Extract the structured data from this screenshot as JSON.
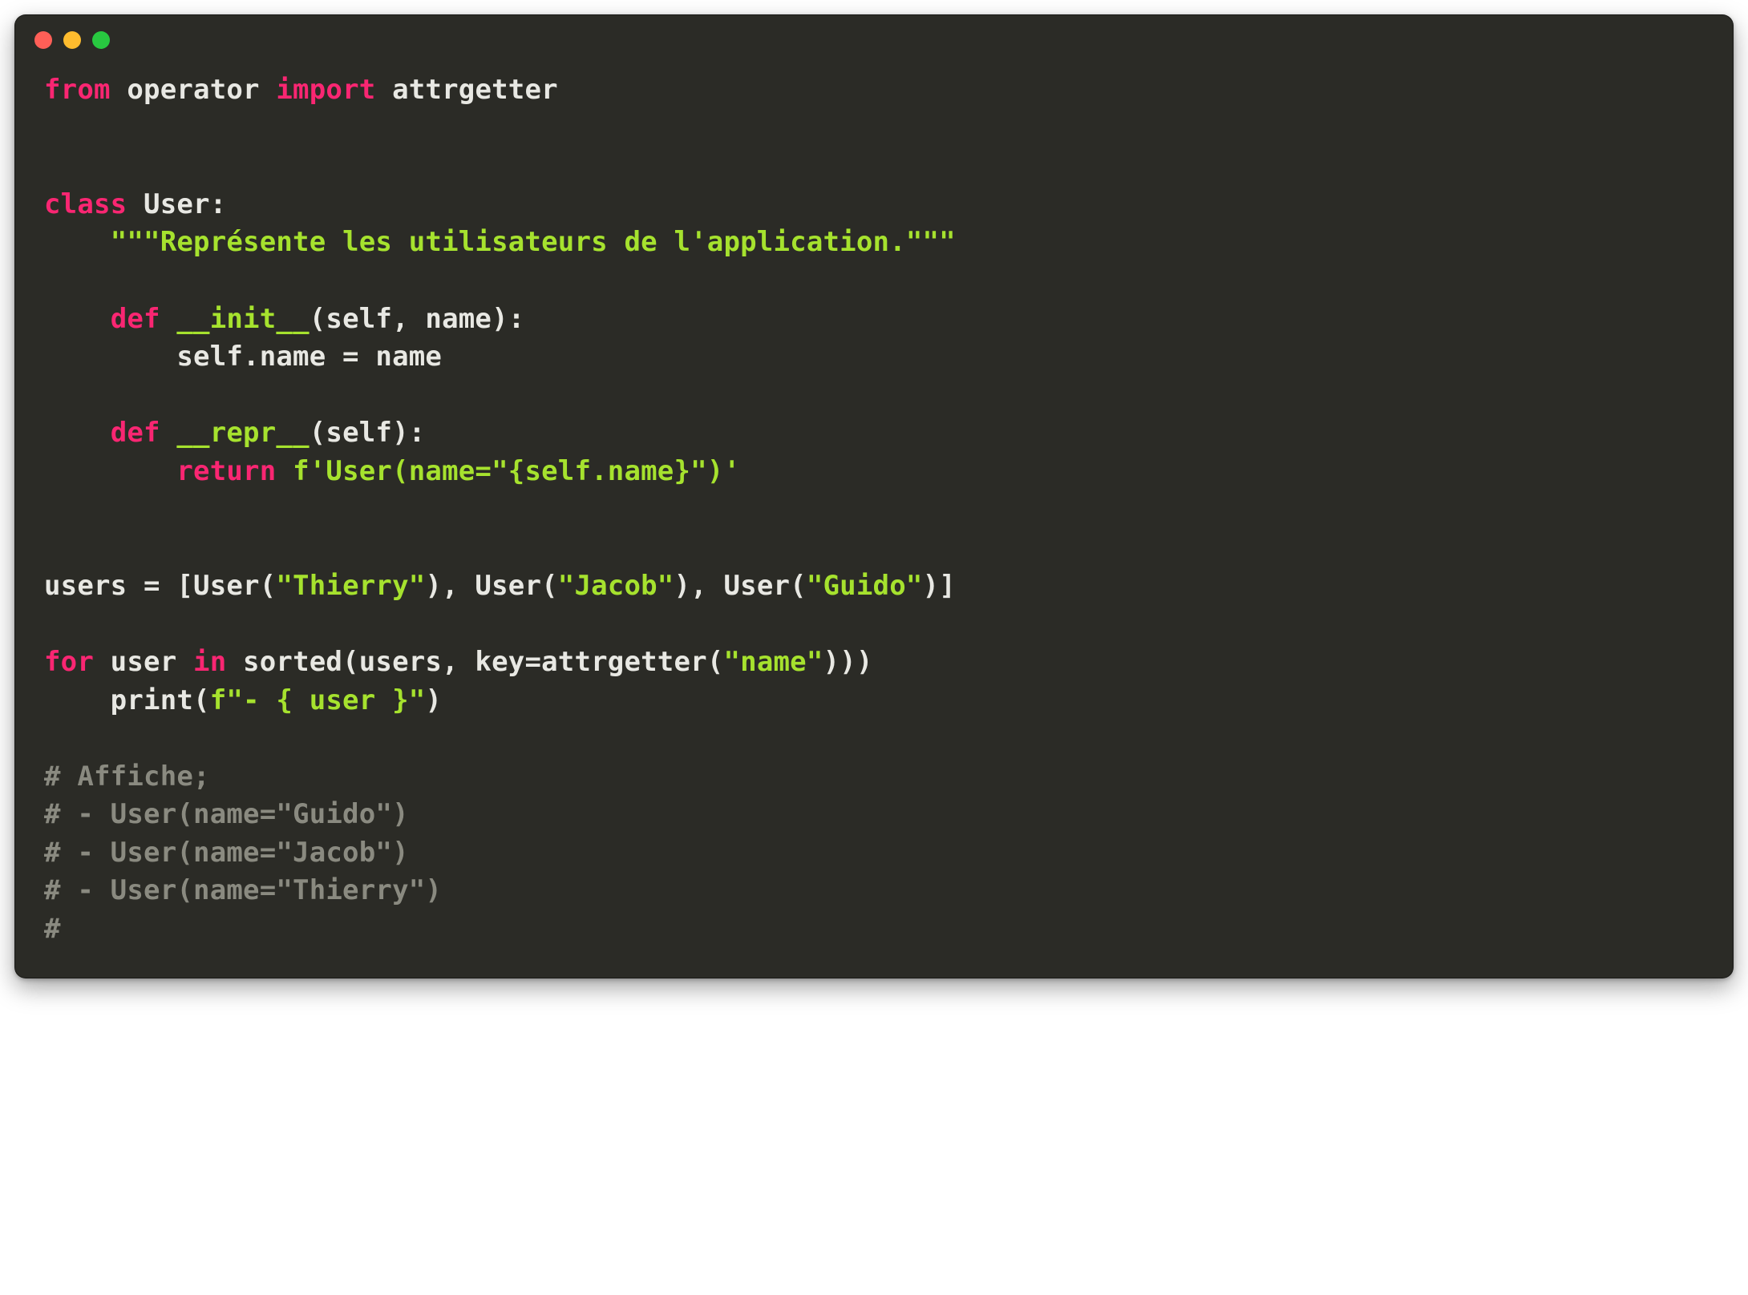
{
  "window": {
    "traffic_lights": [
      "red",
      "yellow",
      "green"
    ]
  },
  "code": {
    "language": "python",
    "tokens": [
      [
        {
          "c": "kw",
          "t": "from"
        },
        {
          "c": "pln",
          "t": " operator "
        },
        {
          "c": "kw",
          "t": "import"
        },
        {
          "c": "pln",
          "t": " attrgetter"
        }
      ],
      [],
      [],
      [
        {
          "c": "kw",
          "t": "class"
        },
        {
          "c": "pln",
          "t": " "
        },
        {
          "c": "def",
          "t": "User"
        },
        {
          "c": "pln",
          "t": ":"
        }
      ],
      [
        {
          "c": "pln",
          "t": "    "
        },
        {
          "c": "str",
          "t": "\"\"\"Représente les utilisateurs de l'application.\"\"\""
        }
      ],
      [],
      [
        {
          "c": "pln",
          "t": "    "
        },
        {
          "c": "kw",
          "t": "def"
        },
        {
          "c": "pln",
          "t": " "
        },
        {
          "c": "fn",
          "t": "__init__"
        },
        {
          "c": "pln",
          "t": "(self, name):"
        }
      ],
      [
        {
          "c": "pln",
          "t": "        self.name = name"
        }
      ],
      [],
      [
        {
          "c": "pln",
          "t": "    "
        },
        {
          "c": "kw",
          "t": "def"
        },
        {
          "c": "pln",
          "t": " "
        },
        {
          "c": "fn",
          "t": "__repr__"
        },
        {
          "c": "pln",
          "t": "(self):"
        }
      ],
      [
        {
          "c": "pln",
          "t": "        "
        },
        {
          "c": "kw",
          "t": "return"
        },
        {
          "c": "pln",
          "t": " "
        },
        {
          "c": "str",
          "t": "f'User(name=\"{self.name}\")'"
        }
      ],
      [],
      [],
      [
        {
          "c": "pln",
          "t": "users = [User("
        },
        {
          "c": "str",
          "t": "\"Thierry\""
        },
        {
          "c": "pln",
          "t": "), User("
        },
        {
          "c": "str",
          "t": "\"Jacob\""
        },
        {
          "c": "pln",
          "t": "), User("
        },
        {
          "c": "str",
          "t": "\"Guido\""
        },
        {
          "c": "pln",
          "t": ")]"
        }
      ],
      [],
      [
        {
          "c": "kw",
          "t": "for"
        },
        {
          "c": "pln",
          "t": " user "
        },
        {
          "c": "kw",
          "t": "in"
        },
        {
          "c": "pln",
          "t": " sorted(users, key=attrgetter("
        },
        {
          "c": "str",
          "t": "\"name\""
        },
        {
          "c": "pln",
          "t": ")))"
        }
      ],
      [
        {
          "c": "pln",
          "t": "    print("
        },
        {
          "c": "str",
          "t": "f\"- { user }\""
        },
        {
          "c": "pln",
          "t": ")"
        }
      ],
      [],
      [
        {
          "c": "cmt",
          "t": "# Affiche;"
        }
      ],
      [
        {
          "c": "cmt",
          "t": "# - User(name=\"Guido\")"
        }
      ],
      [
        {
          "c": "cmt",
          "t": "# - User(name=\"Jacob\")"
        }
      ],
      [
        {
          "c": "cmt",
          "t": "# - User(name=\"Thierry\")"
        }
      ],
      [
        {
          "c": "cmt",
          "t": "#"
        }
      ]
    ]
  }
}
